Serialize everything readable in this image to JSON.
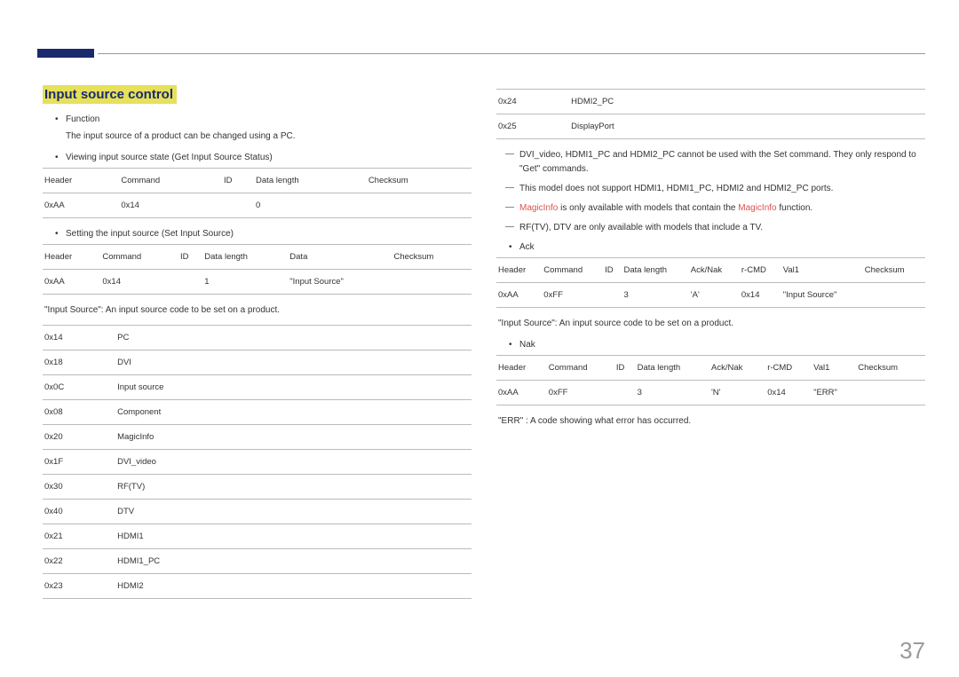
{
  "page_number": "37",
  "heading": "Input source control",
  "left": {
    "function_label": "Function",
    "function_desc": "The input source of a product can be changed using a PC.",
    "viewing_label": "Viewing input source state (Get Input Source Status)",
    "get_table": {
      "headers": [
        "Header",
        "Command",
        "ID",
        "Data length",
        "Checksum"
      ],
      "row": [
        "0xAA",
        "0x14",
        "",
        "0",
        ""
      ]
    },
    "setting_label": "Setting the input source (Set Input Source)",
    "set_table": {
      "headers": [
        "Header",
        "Command",
        "ID",
        "Data length",
        "Data",
        "Checksum"
      ],
      "row": [
        "0xAA",
        "0x14",
        "",
        "1",
        "\"Input Source\"",
        ""
      ]
    },
    "input_source_note": "\"Input Source\": An input source code to be set on a product.",
    "codes": [
      [
        "0x14",
        "PC"
      ],
      [
        "0x18",
        "DVI"
      ],
      [
        "0x0C",
        "Input source"
      ],
      [
        "0x08",
        "Component"
      ],
      [
        "0x20",
        "MagicInfo"
      ],
      [
        "0x1F",
        "DVI_video"
      ],
      [
        "0x30",
        "RF(TV)"
      ],
      [
        "0x40",
        "DTV"
      ],
      [
        "0x21",
        "HDMI1"
      ],
      [
        "0x22",
        "HDMI1_PC"
      ],
      [
        "0x23",
        "HDMI2"
      ]
    ]
  },
  "right": {
    "codes": [
      [
        "0x24",
        "HDMI2_PC"
      ],
      [
        "0x25",
        "DisplayPort"
      ]
    ],
    "dash1": "DVI_video, HDMI1_PC and HDMI2_PC cannot be used with the Set command. They only respond to \"Get\" commands.",
    "dash2": "This model does not support HDMI1, HDMI1_PC, HDMI2 and HDMI2_PC ports.",
    "dash3_pre": "MagicInfo",
    "dash3_mid": " is only available with models that contain the ",
    "dash3_red2": "MagicInfo",
    "dash3_post": " function.",
    "dash4": "RF(TV), DTV are only available with models that include a TV.",
    "ack_label": "Ack",
    "ack_table": {
      "headers": [
        "Header",
        "Command",
        "ID",
        "Data length",
        "Ack/Nak",
        "r-CMD",
        "Val1",
        "Checksum"
      ],
      "row": [
        "0xAA",
        "0xFF",
        "",
        "3",
        "'A'",
        "0x14",
        "\"Input Source\"",
        ""
      ]
    },
    "ack_note": "\"Input Source\": An input source code to be set on a product.",
    "nak_label": "Nak",
    "nak_table": {
      "headers": [
        "Header",
        "Command",
        "ID",
        "Data length",
        "Ack/Nak",
        "r-CMD",
        "Val1",
        "Checksum"
      ],
      "row": [
        "0xAA",
        "0xFF",
        "",
        "3",
        "'N'",
        "0x14",
        "\"ERR\"",
        ""
      ]
    },
    "err_note": "\"ERR\" : A code showing what error has occurred."
  }
}
